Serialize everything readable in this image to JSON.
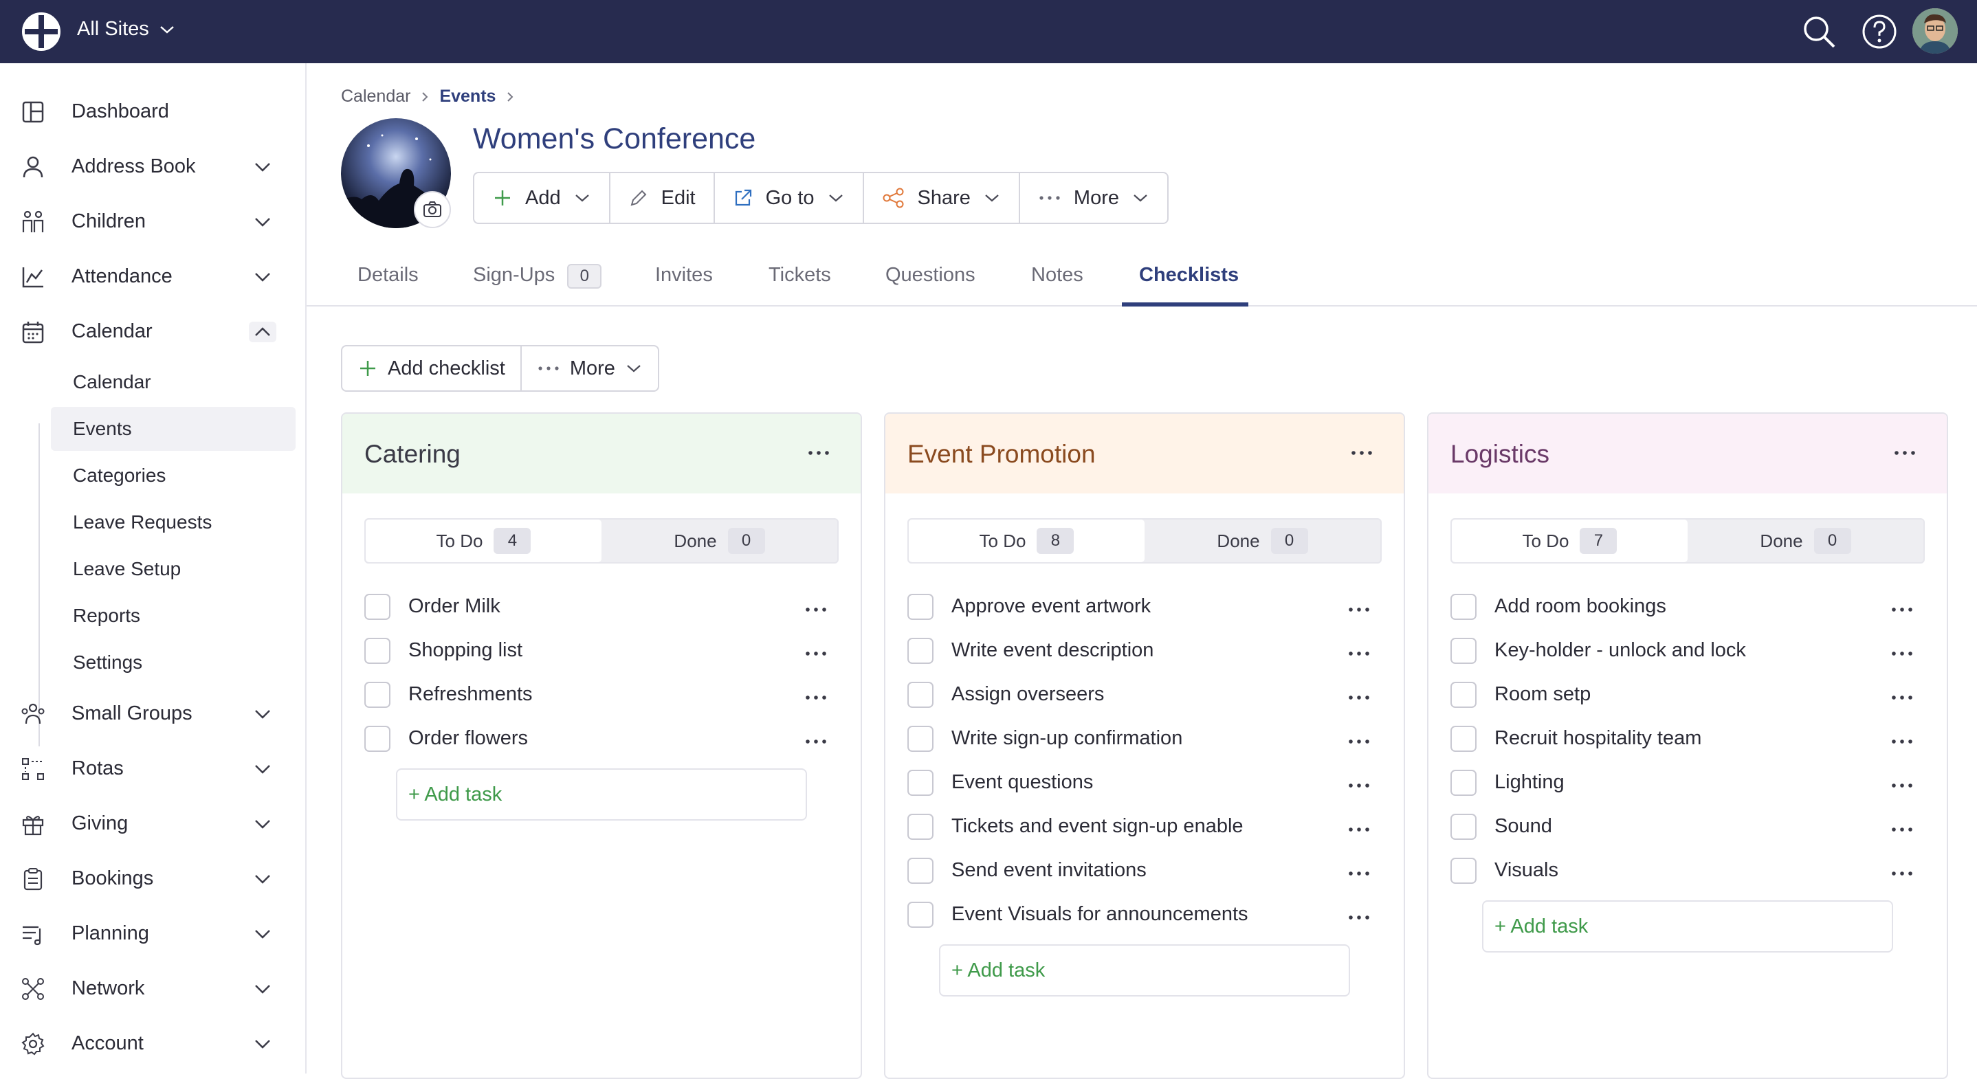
{
  "topbar": {
    "site_label": "All Sites",
    "icons": [
      "church-logo-icon",
      "search-icon",
      "help-icon",
      "user-avatar"
    ]
  },
  "sidebar": {
    "items": [
      {
        "label": "Dashboard",
        "icon": "dashboard-icon"
      },
      {
        "label": "Address Book",
        "icon": "person-icon"
      },
      {
        "label": "Children",
        "icon": "children-icon"
      },
      {
        "label": "Attendance",
        "icon": "chart-icon"
      },
      {
        "label": "Calendar",
        "icon": "calendar-icon"
      },
      {
        "label": "Small Groups",
        "icon": "group-icon"
      },
      {
        "label": "Rotas",
        "icon": "rotas-icon"
      },
      {
        "label": "Giving",
        "icon": "gift-icon"
      },
      {
        "label": "Bookings",
        "icon": "clipboard-icon"
      },
      {
        "label": "Planning",
        "icon": "planning-icon"
      },
      {
        "label": "Network",
        "icon": "network-icon"
      },
      {
        "label": "Account",
        "icon": "gear-icon"
      }
    ],
    "calendar_sub": [
      "Calendar",
      "Events",
      "Categories",
      "Leave Requests",
      "Leave Setup",
      "Reports",
      "Settings"
    ],
    "active_sub": "Events"
  },
  "breadcrumb": {
    "items": [
      "Calendar",
      "Events"
    ]
  },
  "event": {
    "title": "Women's Conference"
  },
  "toolbar": {
    "add": "Add",
    "edit": "Edit",
    "goto": "Go to",
    "share": "Share",
    "more": "More"
  },
  "tabs": [
    {
      "label": "Details"
    },
    {
      "label": "Sign-Ups",
      "count": "0"
    },
    {
      "label": "Invites"
    },
    {
      "label": "Tickets"
    },
    {
      "label": "Questions"
    },
    {
      "label": "Notes"
    },
    {
      "label": "Checklists"
    }
  ],
  "active_tab": "Checklists",
  "actions": {
    "add_checklist": "Add checklist",
    "more": "More"
  },
  "checklists": [
    {
      "title": "Catering",
      "title_color": "#3a3a46",
      "header_color": "#eef8ee",
      "todo_label": "To Do",
      "todo_count": "4",
      "done_label": "Done",
      "done_count": "0",
      "tasks": [
        "Order Milk",
        "Shopping list",
        "Refreshments",
        "Order flowers"
      ],
      "add_task": "+ Add task"
    },
    {
      "title": "Event Promotion",
      "title_color": "#8a4a1f",
      "header_color": "#fff3e8",
      "todo_label": "To Do",
      "todo_count": "8",
      "done_label": "Done",
      "done_count": "0",
      "tasks": [
        "Approve event artwork",
        "Write event description",
        "Assign overseers",
        "Write sign-up confirmation",
        "Event questions",
        "Tickets and event sign-up enable",
        "Send event invitations",
        "Event Visuals for announcements"
      ],
      "add_task": "+ Add task"
    },
    {
      "title": "Logistics",
      "title_color": "#6a3a68",
      "header_color": "#fbf0f8",
      "todo_label": "To Do",
      "todo_count": "7",
      "done_label": "Done",
      "done_count": "0",
      "tasks": [
        "Add room bookings",
        "Key-holder - unlock and lock",
        "Room setp",
        "Recruit hospitality team",
        "Lighting",
        "Sound",
        "Visuals"
      ],
      "add_task": "+ Add task"
    }
  ]
}
